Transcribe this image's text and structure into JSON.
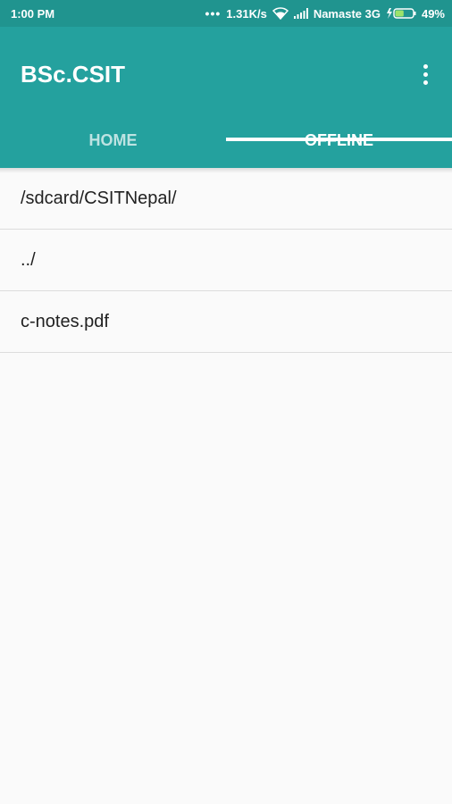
{
  "status_bar": {
    "time": "1:00 PM",
    "network_speed": "1.31K/s",
    "carrier": "Namaste 3G",
    "battery": "49%",
    "battery_level": 0.49
  },
  "app_bar": {
    "title": "BSc.CSIT",
    "menu_icon": "more-vert-icon"
  },
  "tabs": [
    {
      "label": "HOME",
      "active": false
    },
    {
      "label": "OFFLINE",
      "active": true
    }
  ],
  "file_list": {
    "items": [
      {
        "label": "/sdcard/CSITNepal/"
      },
      {
        "label": "../"
      },
      {
        "label": "c-notes.pdf"
      }
    ]
  },
  "colors": {
    "primary": "#24a19e",
    "status_bar": "#20948f",
    "background": "#fafafa"
  }
}
